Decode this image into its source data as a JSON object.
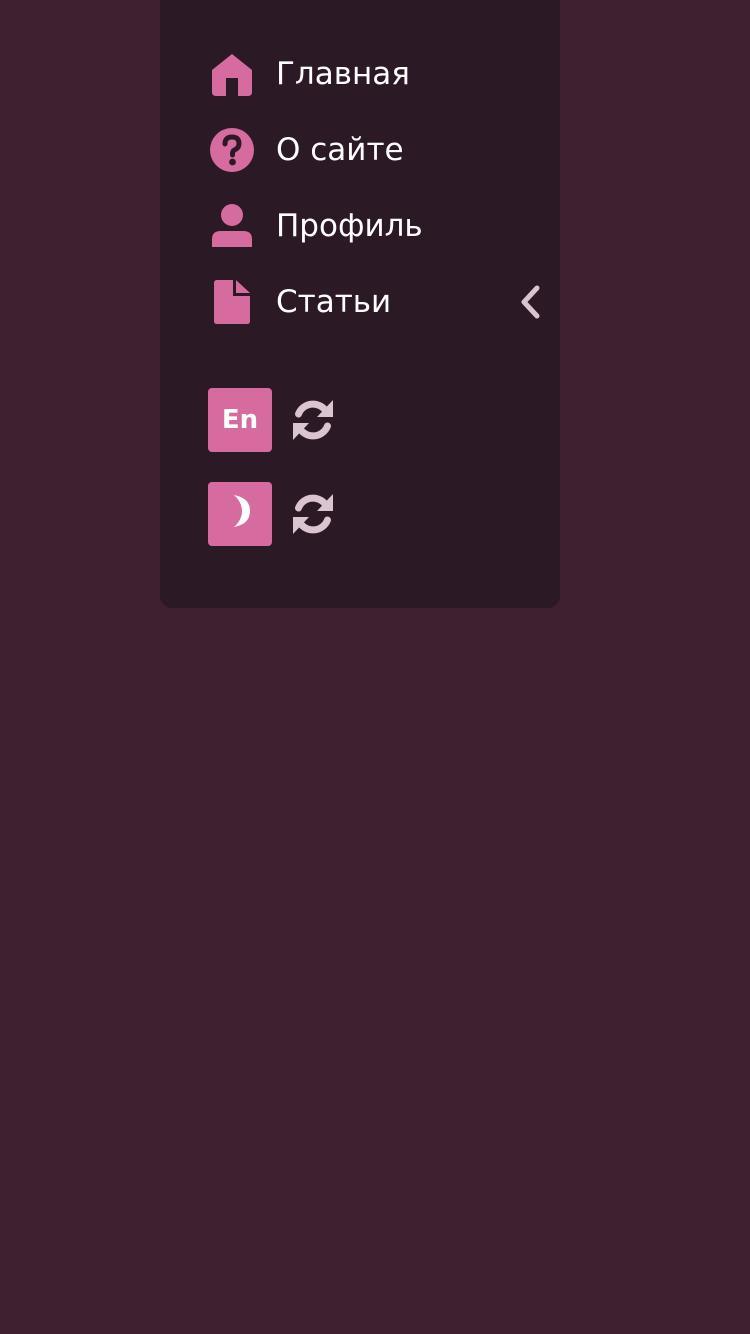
{
  "colors": {
    "background": "#3e2130",
    "panel": "#2c1926",
    "accent": "#d66ba0",
    "text": "#ffffff",
    "muted_icon": "#d9c4cf"
  },
  "nav": {
    "items": [
      {
        "label": "Главная",
        "icon": "home-icon"
      },
      {
        "label": "О сайте",
        "icon": "question-circle-icon"
      },
      {
        "label": "Профиль",
        "icon": "user-icon"
      },
      {
        "label": "Статьи",
        "icon": "file-icon",
        "expand_icon": "chevron-left-icon"
      }
    ]
  },
  "toggles": {
    "language": {
      "label": "En",
      "action_icon": "refresh-icon"
    },
    "theme": {
      "icon": "moon-icon",
      "action_icon": "refresh-icon"
    }
  }
}
